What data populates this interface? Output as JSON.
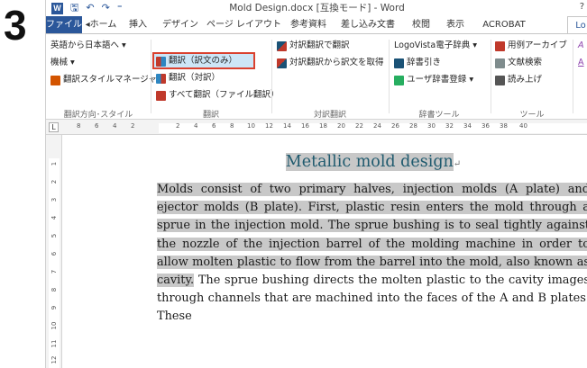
{
  "step_number": "3",
  "window": {
    "title": "Mold Design.docx [互換モード] - Word",
    "help": "?"
  },
  "qat": {
    "app_icon": "W",
    "save": "🖫",
    "undo": "↶",
    "redo": "↷",
    "more": "⁼"
  },
  "tabs": [
    {
      "label": "ファイル",
      "active": false
    },
    {
      "label": "◂ホーム",
      "active": false
    },
    {
      "label": "挿入",
      "active": false
    },
    {
      "label": "デザイン",
      "active": false
    },
    {
      "label": "ページ レイアウト",
      "active": false
    },
    {
      "label": "参考資料",
      "active": false
    },
    {
      "label": "差し込み文書",
      "active": false
    },
    {
      "label": "校閲",
      "active": false
    },
    {
      "label": "表示",
      "active": false
    },
    {
      "label": "ACROBAT",
      "active": false
    },
    {
      "label": "Lo",
      "active": true
    }
  ],
  "ribbon": {
    "group1": {
      "label": "翻訳方向･スタイル",
      "items": [
        "英語から日本語へ ▾",
        "機械 ▾",
        "翻訳スタイルマネージャ"
      ]
    },
    "group2": {
      "label": "翻訳",
      "items": [
        "翻訳（訳文のみ）",
        "翻訳（対訳）",
        "すべて翻訳（ファイル翻訳）"
      ]
    },
    "group3": {
      "label": "対訳翻訳",
      "items": [
        "対訳翻訳で翻訳",
        "対訳翻訳から訳文を取得"
      ]
    },
    "group4": {
      "label": "辞書ツール",
      "items": [
        "LogoVista電子辞典 ▾",
        "辞書引き",
        "ユーザ辞書登録 ▾"
      ]
    },
    "group5": {
      "label": "ツール",
      "items": [
        "用例アーカイブ",
        "文献検索",
        "読み上げ"
      ]
    },
    "group6": {
      "items": [
        "A",
        "A"
      ]
    }
  },
  "colors": {
    "accent": "#2b579a",
    "highlight_border": "#d9412f",
    "selection": "#c8c8c8",
    "title_color": "#1f5a6e"
  },
  "ruler": {
    "corner": "L",
    "labels": [
      "8",
      "6",
      "4",
      "2",
      "2",
      "4",
      "6",
      "8",
      "10",
      "12",
      "14",
      "16",
      "18",
      "20",
      "22",
      "24",
      "26",
      "28",
      "30",
      "32",
      "34",
      "36",
      "38",
      "40"
    ],
    "vlabels": [
      "1",
      "2",
      "3",
      "4",
      "5",
      "6",
      "7",
      "8",
      "9",
      "10",
      "11",
      "12"
    ]
  },
  "document": {
    "title": "Metallic mold design",
    "title_mark": "↵",
    "selected_text": "Molds consist of two primary halves, injection molds (A plate) and ejector molds (B plate). First, plastic resin enters the mold through a sprue in the injection mold. The sprue bushing is to seal tightly against the nozzle of the injection barrel of the molding machine in order to allow molten plastic to flow from the barrel into the mold, also known as cavity.",
    "rest_text": " The sprue bushing directs the molten plastic to the cavity images through channels that are machined into the faces of the A and B plates. These"
  }
}
